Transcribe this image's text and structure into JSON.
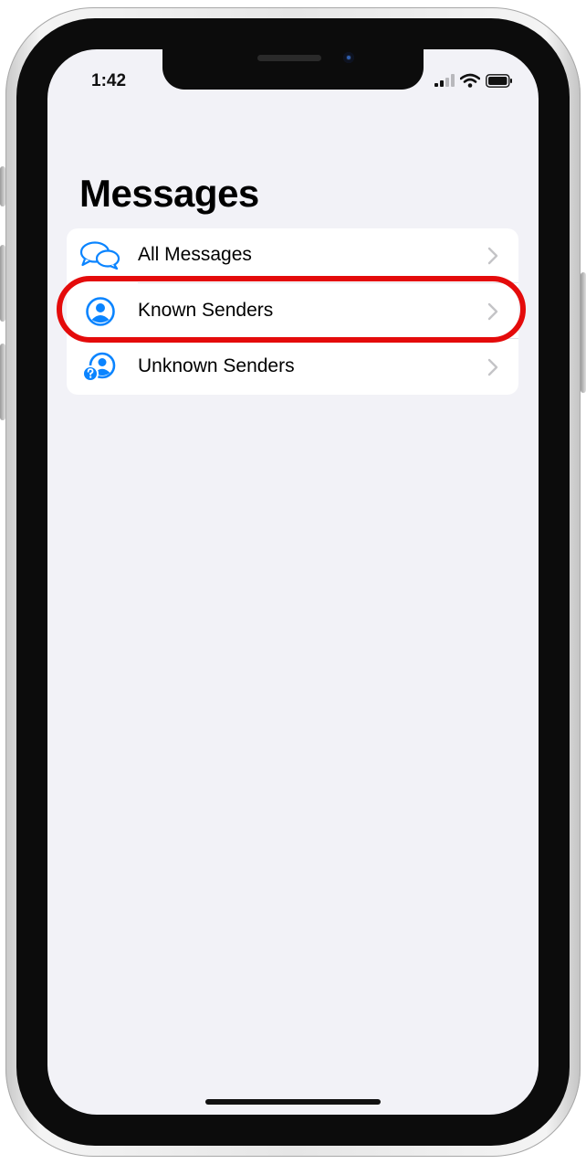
{
  "status_bar": {
    "time": "1:42",
    "icons": [
      "signal-icon",
      "wifi-icon",
      "battery-icon"
    ]
  },
  "page": {
    "title": "Messages"
  },
  "filter_list": {
    "items": [
      {
        "label": "All Messages",
        "icon": "chat-bubbles-icon"
      },
      {
        "label": "Known Senders",
        "icon": "person-circle-icon"
      },
      {
        "label": "Unknown Senders",
        "icon": "person-question-icon"
      }
    ],
    "highlighted_item": "Known Senders"
  },
  "colors": {
    "accent": "#0a84ff",
    "highlight": "#e40b0b",
    "background": "#f2f2f7",
    "chevron": "#c4c4c7"
  }
}
